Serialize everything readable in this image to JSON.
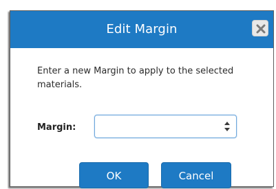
{
  "dialog": {
    "title": "Edit Margin",
    "message": "Enter a new Margin to apply to the selected materials.",
    "margin_label": "Margin:",
    "margin_value": "",
    "ok_label": "OK",
    "cancel_label": "Cancel"
  },
  "icons": {
    "close": "close-icon",
    "spinner": "spinner-icon"
  },
  "colors": {
    "accent": "#1e7ac4",
    "title_text": "#ffffff",
    "close_button_bg": "#e8e8e8",
    "input_border": "#6fa8dc"
  }
}
